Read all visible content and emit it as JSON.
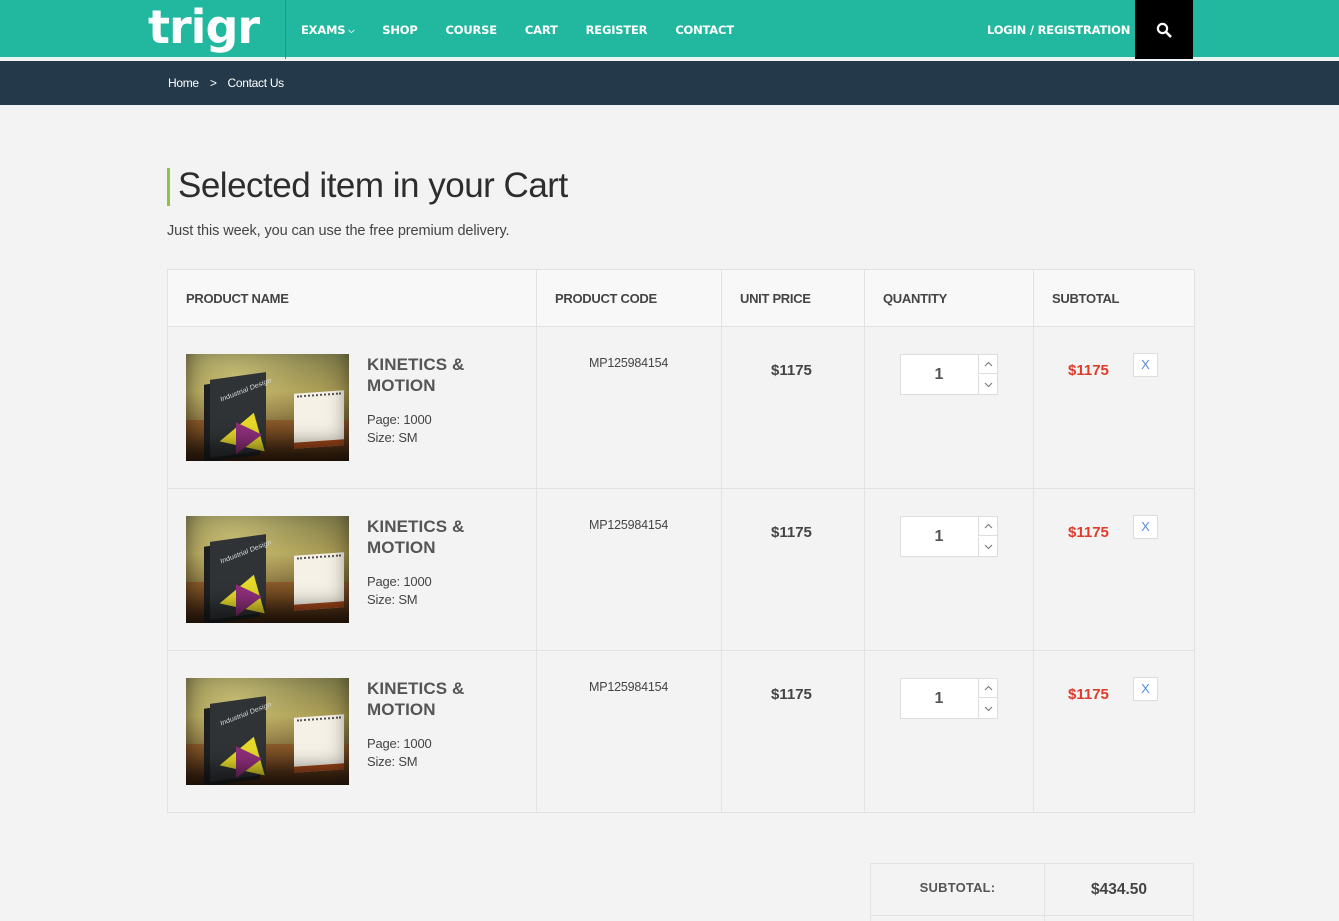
{
  "header": {
    "logo_text": "trigr",
    "nav": [
      {
        "label": "EXAMS",
        "has_dropdown": true
      },
      {
        "label": "SHOP"
      },
      {
        "label": "COURSE"
      },
      {
        "label": "CART"
      },
      {
        "label": "REGISTER"
      },
      {
        "label": "CONTACT"
      }
    ],
    "login_label": "LOGIN / REGISTRATION",
    "search_icon": "search-icon"
  },
  "breadcrumb": {
    "home": "Home",
    "separator": ">",
    "current": "Contact Us"
  },
  "page": {
    "title": "Selected item in your Cart",
    "subtitle": "Just this week, you can use the free premium delivery."
  },
  "cart_table": {
    "headers": [
      "PRODUCT NAME",
      "PRODUCT CODE",
      "UNIT PRICE",
      "QUANTITY",
      "SUBTOTAL"
    ],
    "rows": [
      {
        "name_line1": "KINETICS &",
        "name_line2": "MOTION",
        "page": "Page: 1000",
        "size": "Size: SM",
        "code": "MP125984154",
        "unit_price": "$1175",
        "quantity": "1",
        "subtotal": "$1175",
        "remove": "X",
        "image_text": "Industrial Design"
      },
      {
        "name_line1": "KINETICS &",
        "name_line2": "MOTION",
        "page": "Page: 1000",
        "size": "Size: SM",
        "code": "MP125984154",
        "unit_price": "$1175",
        "quantity": "1",
        "subtotal": "$1175",
        "remove": "X",
        "image_text": "Industrial Design"
      },
      {
        "name_line1": "KINETICS &",
        "name_line2": "MOTION",
        "page": "Page: 1000",
        "size": "Size: SM",
        "code": "MP125984154",
        "unit_price": "$1175",
        "quantity": "1",
        "subtotal": "$1175",
        "remove": "X",
        "image_text": "Industrial Design"
      }
    ]
  },
  "totals": {
    "subtotal_label": "SUBTOTAL:",
    "subtotal_value": "$434.50"
  },
  "colors": {
    "header_bg": "#21b89f",
    "breadcrumb_bg": "#243a4a",
    "accent_bar": "#8cc63e",
    "price_red": "#e03a2a",
    "remove_blue": "#5b8fd8"
  }
}
